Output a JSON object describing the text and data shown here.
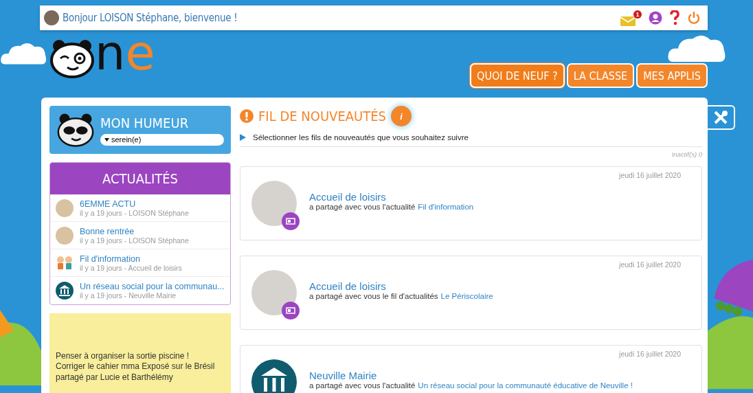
{
  "top_bar": {
    "greeting": "Bonjour LOISON Stéphane, bienvenue !",
    "mail_badge": "1"
  },
  "nav": [
    {
      "label": "QUOI DE NEUF ?",
      "selected": true
    },
    {
      "label": "LA CLASSE",
      "selected": false
    },
    {
      "label": "MES APPLIS",
      "selected": false
    }
  ],
  "logo": {
    "text_dark": "n",
    "text_accent": "e"
  },
  "mood": {
    "title": "MON HUMEUR",
    "value": "serein(e)"
  },
  "news": {
    "title": "ACTUALITÉS",
    "items": [
      {
        "title": "6EMME ACTU",
        "meta": "il y a 19 jours - LOISON Stéphane",
        "kind": "photo"
      },
      {
        "title": "Bonne rentrée",
        "meta": "il y a 19 jours - LOISON Stéphane",
        "kind": "photo"
      },
      {
        "title": "Fil d'information",
        "meta": "il y a 19 jours - Accueil de loisirs",
        "kind": "kids"
      },
      {
        "title": "Un réseau social pour la communau...",
        "meta": "il y a 19 jours - Neuville Mairie",
        "kind": "building"
      }
    ]
  },
  "note": {
    "text": "Penser à organiser la sortie piscine !\nCorriger le cahier mma Exposé sur le Brésil partagé par Lucie et Barthélémy"
  },
  "feed": {
    "title": "FIL DE NOUVEAUTÉS",
    "info": "i",
    "filter": "Sélectionner les fils de nouveautés que vous souhaitez suivre",
    "inactive": "Inactif(s) 0",
    "items": [
      {
        "date": "jeudi 16 juillet 2020",
        "author": "Accueil de loisirs",
        "action": "a partagé avec vous l'actualité",
        "link": "Fil d'information",
        "kind": "person"
      },
      {
        "date": "jeudi 16 juillet 2020",
        "author": "Accueil de loisirs",
        "action": "a partagé avec vous le fil d'actualités",
        "link": "Le Périscolaire",
        "kind": "person"
      },
      {
        "date": "jeudi 16 juillet 2020",
        "author": "Neuville Mairie",
        "action": "a partagé avec vous l'actualité",
        "link": "Un réseau social pour la communauté éducative de Neuville !",
        "kind": "building"
      }
    ]
  }
}
